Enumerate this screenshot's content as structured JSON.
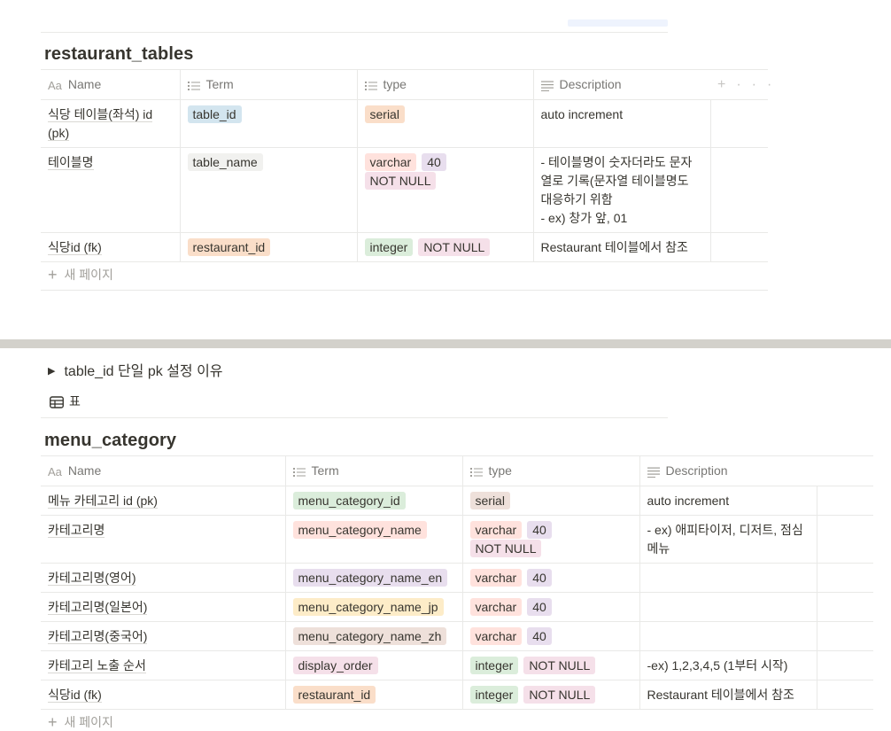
{
  "table1": {
    "title": "restaurant_tables",
    "headers": {
      "name": "Name",
      "term": "Term",
      "type": "type",
      "description": "Description"
    },
    "rows": [
      {
        "name": "식당 테이블(좌석) id (pk)",
        "term": "table_id",
        "term_color": "blue",
        "types": [
          {
            "label": "serial",
            "color": "orange"
          }
        ],
        "description": "auto increment"
      },
      {
        "name": "테이블명",
        "term": "table_name",
        "term_color": "default",
        "types": [
          {
            "label": "varchar",
            "color": "red"
          },
          {
            "label": "40",
            "color": "purple"
          },
          {
            "label": "NOT NULL",
            "color": "pink"
          }
        ],
        "description": "- 테이블명이 숫자더라도 문자열로 기록(문자열 테이블명도 대응하기 위함\n- ex) 창가 앞, 01"
      },
      {
        "name": "식당id (fk)",
        "term": "restaurant_id",
        "term_color": "orange",
        "types": [
          {
            "label": "integer",
            "color": "green"
          },
          {
            "label": "NOT NULL",
            "color": "pink"
          }
        ],
        "description": "Restaurant 테이블에서 참조"
      }
    ],
    "new_page": "새 페이지"
  },
  "toggle": {
    "label": "table_id 단일 pk 설정 이유"
  },
  "view_tab": {
    "label": "표"
  },
  "table2": {
    "title": "menu_category",
    "headers": {
      "name": "Name",
      "term": "Term",
      "type": "type",
      "description": "Description"
    },
    "rows": [
      {
        "name": "메뉴 카테고리 id (pk)",
        "term": "menu_category_id",
        "term_color": "green",
        "types": [
          {
            "label": "serial",
            "color": "brown"
          }
        ],
        "description": "auto increment"
      },
      {
        "name": "카테고리명",
        "term": "menu_category_name",
        "term_color": "red",
        "types": [
          {
            "label": "varchar",
            "color": "red"
          },
          {
            "label": "40",
            "color": "purple"
          },
          {
            "label": "NOT NULL",
            "color": "pink"
          }
        ],
        "description": "- ex) 애피타이저, 디저트, 점심메뉴"
      },
      {
        "name": "카테고리명(영어)",
        "term": "menu_category_name_en",
        "term_color": "purple",
        "types": [
          {
            "label": "varchar",
            "color": "red"
          },
          {
            "label": "40",
            "color": "purple"
          }
        ],
        "description": ""
      },
      {
        "name": "카테고리명(일본어)",
        "term": "menu_category_name_jp",
        "term_color": "yellow",
        "types": [
          {
            "label": "varchar",
            "color": "red"
          },
          {
            "label": "40",
            "color": "purple"
          }
        ],
        "description": ""
      },
      {
        "name": "카테고리명(중국어)",
        "term": "menu_category_name_zh",
        "term_color": "brown",
        "types": [
          {
            "label": "varchar",
            "color": "red"
          },
          {
            "label": "40",
            "color": "purple"
          }
        ],
        "description": ""
      },
      {
        "name": "카테고리 노출 순서",
        "term": "display_order",
        "term_color": "pink",
        "types": [
          {
            "label": "integer",
            "color": "green"
          },
          {
            "label": "NOT NULL",
            "color": "pink"
          }
        ],
        "description": "-ex) 1,2,3,4,5 (1부터 시작)"
      },
      {
        "name": "식당id (fk)",
        "term": "restaurant_id",
        "term_color": "orange",
        "types": [
          {
            "label": "integer",
            "color": "green"
          },
          {
            "label": "NOT NULL",
            "color": "pink"
          }
        ],
        "description": "Restaurant 테이블에서 참조"
      }
    ],
    "new_page": "새 페이지"
  },
  "icons": {
    "name_header": "text-property-icon",
    "term_header": "list-property-icon",
    "type_header": "list-property-icon",
    "description_header": "text-lines-icon",
    "add_column": "plus-icon",
    "more": "ellipsis-icon",
    "toggle": "triangle-right-icon",
    "table_view": "table-icon"
  }
}
